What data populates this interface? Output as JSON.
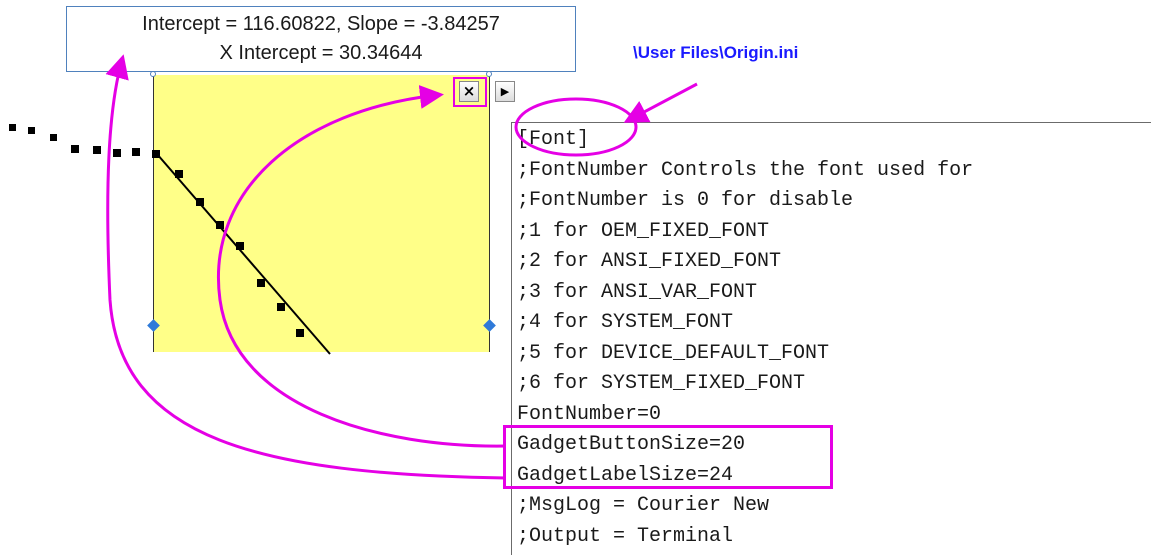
{
  "gadget": {
    "label_line1": "Intercept = 116.60822, Slope = -3.84257",
    "label_line2": "X Intercept = 30.34644",
    "close_button": "×",
    "menu_button": "▶"
  },
  "path_label": "\\User Files\\Origin.ini",
  "ini_lines": [
    "[Font]",
    ";FontNumber Controls the font used for",
    ";FontNumber is 0 for disable",
    ";1 for OEM_FIXED_FONT",
    ";2 for ANSI_FIXED_FONT",
    ";3 for ANSI_VAR_FONT",
    ";4 for SYSTEM_FONT",
    ";5 for DEVICE_DEFAULT_FONT",
    ";6 for SYSTEM_FIXED_FONT",
    "FontNumber=0",
    "GadgetButtonSize=20",
    "GadgetLabelSize=24",
    ";MsgLog = Courier New",
    ";Output = Terminal"
  ],
  "colors": {
    "annotation": "#e500e5",
    "roi_fill": "#ffff88",
    "path_text": "#1a1aff",
    "handle": "#2f7ad9"
  }
}
